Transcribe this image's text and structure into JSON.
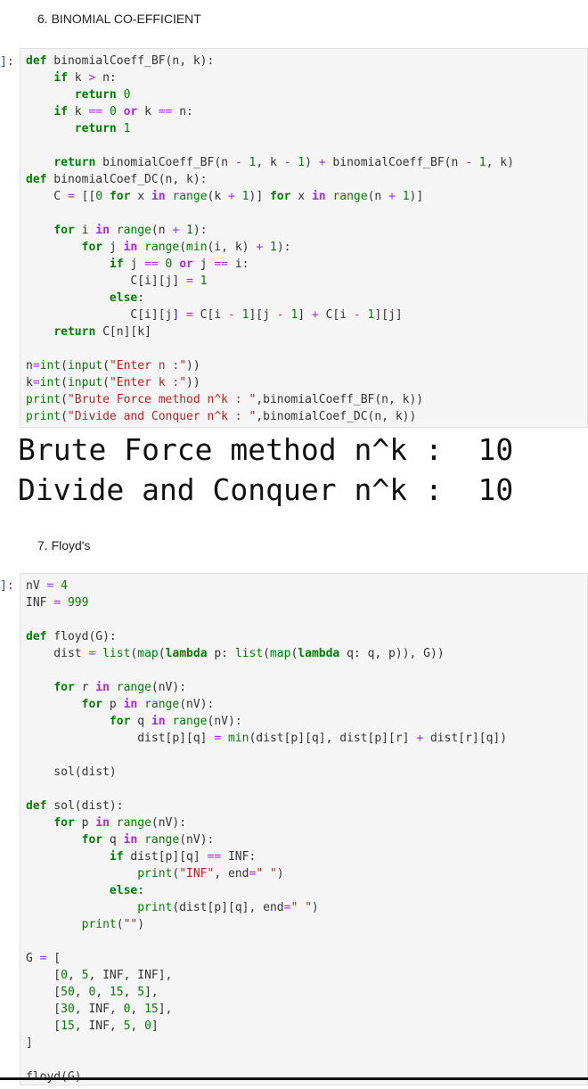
{
  "section1": {
    "heading": "6. BINOMIAL CO-EFFICIENT",
    "prompt": "]:",
    "output_lines": [
      "Brute Force method n^k :  10",
      "Divide and Conquer n^k :  10"
    ]
  },
  "section2": {
    "heading": "7. Floyd's",
    "prompt": "]:"
  },
  "code1": [
    [
      [
        "kw",
        "def"
      ],
      [
        "t",
        " binomialCoeff_BF(n, k):"
      ]
    ],
    [
      [
        "t",
        "    "
      ],
      [
        "kw",
        "if"
      ],
      [
        "t",
        " k "
      ],
      [
        "op",
        ">"
      ],
      [
        "t",
        " n:"
      ]
    ],
    [
      [
        "t",
        "       "
      ],
      [
        "kw",
        "return"
      ],
      [
        "t",
        " "
      ],
      [
        "num",
        "0"
      ]
    ],
    [
      [
        "t",
        "    "
      ],
      [
        "kw",
        "if"
      ],
      [
        "t",
        " k "
      ],
      [
        "op",
        "=="
      ],
      [
        "t",
        " "
      ],
      [
        "num",
        "0"
      ],
      [
        "t",
        " "
      ],
      [
        "kwp",
        "or"
      ],
      [
        "t",
        " k "
      ],
      [
        "op",
        "=="
      ],
      [
        "t",
        " n:"
      ]
    ],
    [
      [
        "t",
        "       "
      ],
      [
        "kw",
        "return"
      ],
      [
        "t",
        " "
      ],
      [
        "num",
        "1"
      ]
    ],
    [],
    [
      [
        "t",
        "    "
      ],
      [
        "kw",
        "return"
      ],
      [
        "t",
        " binomialCoeff_BF(n "
      ],
      [
        "op",
        "-"
      ],
      [
        "t",
        " "
      ],
      [
        "num",
        "1"
      ],
      [
        "t",
        ", k "
      ],
      [
        "op",
        "-"
      ],
      [
        "t",
        " "
      ],
      [
        "num",
        "1"
      ],
      [
        "t",
        ") "
      ],
      [
        "op",
        "+"
      ],
      [
        "t",
        " binomialCoeff_BF(n "
      ],
      [
        "op",
        "-"
      ],
      [
        "t",
        " "
      ],
      [
        "num",
        "1"
      ],
      [
        "t",
        ", k)"
      ]
    ],
    [
      [
        "kw",
        "def"
      ],
      [
        "t",
        " binomialCoef_DC(n, k):"
      ]
    ],
    [
      [
        "t",
        "    C "
      ],
      [
        "op",
        "="
      ],
      [
        "t",
        " [["
      ],
      [
        "num",
        "0"
      ],
      [
        "t",
        " "
      ],
      [
        "kw",
        "for"
      ],
      [
        "t",
        " x "
      ],
      [
        "kwp",
        "in"
      ],
      [
        "t",
        " "
      ],
      [
        "bi",
        "range"
      ],
      [
        "t",
        "(k "
      ],
      [
        "op",
        "+"
      ],
      [
        "t",
        " "
      ],
      [
        "num",
        "1"
      ],
      [
        "t",
        ")] "
      ],
      [
        "kw",
        "for"
      ],
      [
        "t",
        " x "
      ],
      [
        "kwp",
        "in"
      ],
      [
        "t",
        " "
      ],
      [
        "bi",
        "range"
      ],
      [
        "t",
        "(n "
      ],
      [
        "op",
        "+"
      ],
      [
        "t",
        " "
      ],
      [
        "num",
        "1"
      ],
      [
        "t",
        ")]"
      ]
    ],
    [],
    [
      [
        "t",
        "    "
      ],
      [
        "kw",
        "for"
      ],
      [
        "t",
        " i "
      ],
      [
        "kwp",
        "in"
      ],
      [
        "t",
        " "
      ],
      [
        "bi",
        "range"
      ],
      [
        "t",
        "(n "
      ],
      [
        "op",
        "+"
      ],
      [
        "t",
        " "
      ],
      [
        "num",
        "1"
      ],
      [
        "t",
        "):"
      ]
    ],
    [
      [
        "t",
        "        "
      ],
      [
        "kw",
        "for"
      ],
      [
        "t",
        " j "
      ],
      [
        "kwp",
        "in"
      ],
      [
        "t",
        " "
      ],
      [
        "bi",
        "range"
      ],
      [
        "t",
        "("
      ],
      [
        "bi",
        "min"
      ],
      [
        "t",
        "(i, k) "
      ],
      [
        "op",
        "+"
      ],
      [
        "t",
        " "
      ],
      [
        "num",
        "1"
      ],
      [
        "t",
        "):"
      ]
    ],
    [
      [
        "t",
        "            "
      ],
      [
        "kw",
        "if"
      ],
      [
        "t",
        " j "
      ],
      [
        "op",
        "=="
      ],
      [
        "t",
        " "
      ],
      [
        "num",
        "0"
      ],
      [
        "t",
        " "
      ],
      [
        "kwp",
        "or"
      ],
      [
        "t",
        " j "
      ],
      [
        "op",
        "=="
      ],
      [
        "t",
        " i:"
      ]
    ],
    [
      [
        "t",
        "               C[i][j] "
      ],
      [
        "op",
        "="
      ],
      [
        "t",
        " "
      ],
      [
        "num",
        "1"
      ]
    ],
    [
      [
        "t",
        "            "
      ],
      [
        "kw",
        "else"
      ],
      [
        "t",
        ":"
      ]
    ],
    [
      [
        "t",
        "               C[i][j] "
      ],
      [
        "op",
        "="
      ],
      [
        "t",
        " C[i "
      ],
      [
        "op",
        "-"
      ],
      [
        "t",
        " "
      ],
      [
        "num",
        "1"
      ],
      [
        "t",
        "][j "
      ],
      [
        "op",
        "-"
      ],
      [
        "t",
        " "
      ],
      [
        "num",
        "1"
      ],
      [
        "t",
        "] "
      ],
      [
        "op",
        "+"
      ],
      [
        "t",
        " C[i "
      ],
      [
        "op",
        "-"
      ],
      [
        "t",
        " "
      ],
      [
        "num",
        "1"
      ],
      [
        "t",
        "][j]"
      ]
    ],
    [
      [
        "t",
        "    "
      ],
      [
        "kw",
        "return"
      ],
      [
        "t",
        " C[n][k]"
      ]
    ],
    [],
    [
      [
        "t",
        "n"
      ],
      [
        "op",
        "="
      ],
      [
        "bi",
        "int"
      ],
      [
        "t",
        "("
      ],
      [
        "bi",
        "input"
      ],
      [
        "t",
        "("
      ],
      [
        "str",
        "\"Enter n :\""
      ],
      [
        "t",
        "))"
      ]
    ],
    [
      [
        "t",
        "k"
      ],
      [
        "op",
        "="
      ],
      [
        "bi",
        "int"
      ],
      [
        "t",
        "("
      ],
      [
        "bi",
        "input"
      ],
      [
        "t",
        "("
      ],
      [
        "str",
        "\"Enter k :\""
      ],
      [
        "t",
        "))"
      ]
    ],
    [
      [
        "bi",
        "print"
      ],
      [
        "t",
        "("
      ],
      [
        "str",
        "\"Brute Force method n^k : \""
      ],
      [
        "t",
        ",binomialCoeff_BF(n, k))"
      ]
    ],
    [
      [
        "bi",
        "print"
      ],
      [
        "t",
        "("
      ],
      [
        "str",
        "\"Divide and Conquer n^k : \""
      ],
      [
        "t",
        ",binomialCoef_DC(n, k))"
      ]
    ]
  ],
  "code2": [
    [
      [
        "t",
        "nV "
      ],
      [
        "op",
        "="
      ],
      [
        "t",
        " "
      ],
      [
        "num",
        "4"
      ]
    ],
    [
      [
        "t",
        "INF "
      ],
      [
        "op",
        "="
      ],
      [
        "t",
        " "
      ],
      [
        "num",
        "999"
      ]
    ],
    [],
    [
      [
        "kw",
        "def"
      ],
      [
        "t",
        " floyd(G):"
      ]
    ],
    [
      [
        "t",
        "    dist "
      ],
      [
        "op",
        "="
      ],
      [
        "t",
        " "
      ],
      [
        "bi",
        "list"
      ],
      [
        "t",
        "("
      ],
      [
        "bi",
        "map"
      ],
      [
        "t",
        "("
      ],
      [
        "kw",
        "lambda"
      ],
      [
        "t",
        " p: "
      ],
      [
        "bi",
        "list"
      ],
      [
        "t",
        "("
      ],
      [
        "bi",
        "map"
      ],
      [
        "t",
        "("
      ],
      [
        "kw",
        "lambda"
      ],
      [
        "t",
        " q: q, p)), G))"
      ]
    ],
    [],
    [
      [
        "t",
        "    "
      ],
      [
        "kw",
        "for"
      ],
      [
        "t",
        " r "
      ],
      [
        "kwp",
        "in"
      ],
      [
        "t",
        " "
      ],
      [
        "bi",
        "range"
      ],
      [
        "t",
        "(nV):"
      ]
    ],
    [
      [
        "t",
        "        "
      ],
      [
        "kw",
        "for"
      ],
      [
        "t",
        " p "
      ],
      [
        "kwp",
        "in"
      ],
      [
        "t",
        " "
      ],
      [
        "bi",
        "range"
      ],
      [
        "t",
        "(nV):"
      ]
    ],
    [
      [
        "t",
        "            "
      ],
      [
        "kw",
        "for"
      ],
      [
        "t",
        " q "
      ],
      [
        "kwp",
        "in"
      ],
      [
        "t",
        " "
      ],
      [
        "bi",
        "range"
      ],
      [
        "t",
        "(nV):"
      ]
    ],
    [
      [
        "t",
        "                dist[p][q] "
      ],
      [
        "op",
        "="
      ],
      [
        "t",
        " "
      ],
      [
        "bi",
        "min"
      ],
      [
        "t",
        "(dist[p][q], dist[p][r] "
      ],
      [
        "op",
        "+"
      ],
      [
        "t",
        " dist[r][q])"
      ]
    ],
    [],
    [
      [
        "t",
        "    sol(dist)"
      ]
    ],
    [],
    [
      [
        "kw",
        "def"
      ],
      [
        "t",
        " sol(dist):"
      ]
    ],
    [
      [
        "t",
        "    "
      ],
      [
        "kw",
        "for"
      ],
      [
        "t",
        " p "
      ],
      [
        "kwp",
        "in"
      ],
      [
        "t",
        " "
      ],
      [
        "bi",
        "range"
      ],
      [
        "t",
        "(nV):"
      ]
    ],
    [
      [
        "t",
        "        "
      ],
      [
        "kw",
        "for"
      ],
      [
        "t",
        " q "
      ],
      [
        "kwp",
        "in"
      ],
      [
        "t",
        " "
      ],
      [
        "bi",
        "range"
      ],
      [
        "t",
        "(nV):"
      ]
    ],
    [
      [
        "t",
        "            "
      ],
      [
        "kw",
        "if"
      ],
      [
        "t",
        " dist[p][q] "
      ],
      [
        "op",
        "=="
      ],
      [
        "t",
        " INF:"
      ]
    ],
    [
      [
        "t",
        "                "
      ],
      [
        "bi",
        "print"
      ],
      [
        "t",
        "("
      ],
      [
        "str",
        "\"INF\""
      ],
      [
        "t",
        ", end"
      ],
      [
        "op",
        "="
      ],
      [
        "str",
        "\" \""
      ],
      [
        "t",
        ")"
      ]
    ],
    [
      [
        "t",
        "            "
      ],
      [
        "kw",
        "else"
      ],
      [
        "t",
        ":"
      ]
    ],
    [
      [
        "t",
        "                "
      ],
      [
        "bi",
        "print"
      ],
      [
        "t",
        "(dist[p][q], end"
      ],
      [
        "op",
        "="
      ],
      [
        "str",
        "\" \""
      ],
      [
        "t",
        ")"
      ]
    ],
    [
      [
        "t",
        "        "
      ],
      [
        "bi",
        "print"
      ],
      [
        "t",
        "("
      ],
      [
        "str",
        "\"\""
      ],
      [
        "t",
        ")"
      ]
    ],
    [],
    [
      [
        "t",
        "G "
      ],
      [
        "op",
        "="
      ],
      [
        "t",
        " ["
      ]
    ],
    [
      [
        "t",
        "    ["
      ],
      [
        "num",
        "0"
      ],
      [
        "t",
        ", "
      ],
      [
        "num",
        "5"
      ],
      [
        "t",
        ", INF, INF],"
      ]
    ],
    [
      [
        "t",
        "    ["
      ],
      [
        "num",
        "50"
      ],
      [
        "t",
        ", "
      ],
      [
        "num",
        "0"
      ],
      [
        "t",
        ", "
      ],
      [
        "num",
        "15"
      ],
      [
        "t",
        ", "
      ],
      [
        "num",
        "5"
      ],
      [
        "t",
        "],"
      ]
    ],
    [
      [
        "t",
        "    ["
      ],
      [
        "num",
        "30"
      ],
      [
        "t",
        ", INF, "
      ],
      [
        "num",
        "0"
      ],
      [
        "t",
        ", "
      ],
      [
        "num",
        "15"
      ],
      [
        "t",
        "],"
      ]
    ],
    [
      [
        "t",
        "    ["
      ],
      [
        "num",
        "15"
      ],
      [
        "t",
        ", INF, "
      ],
      [
        "num",
        "5"
      ],
      [
        "t",
        ", "
      ],
      [
        "num",
        "0"
      ],
      [
        "t",
        "]"
      ]
    ],
    [
      [
        "t",
        "]"
      ]
    ],
    [],
    [
      [
        "t",
        "floyd(G)"
      ]
    ]
  ]
}
